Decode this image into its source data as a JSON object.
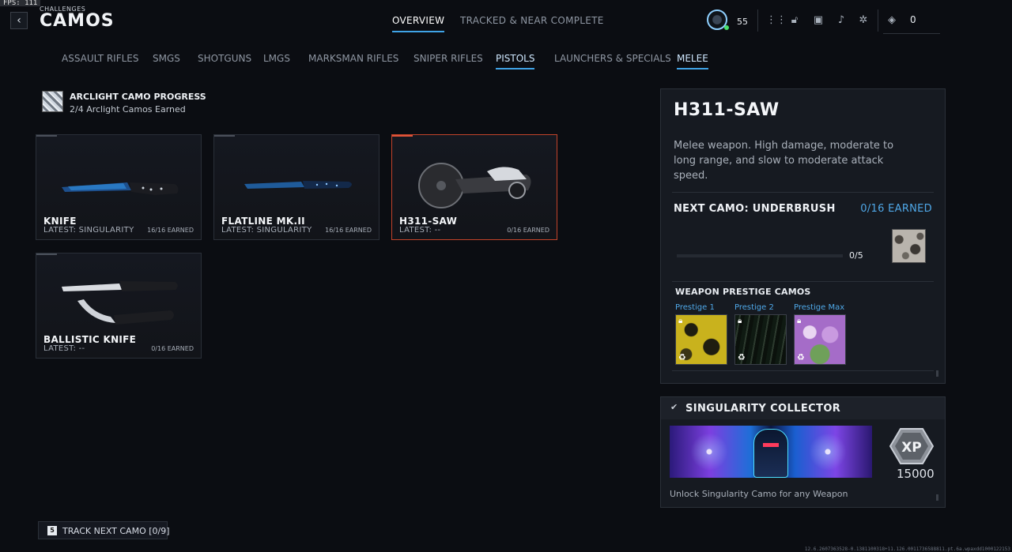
{
  "debug": {
    "fps": "FPS: 111"
  },
  "header": {
    "back_glyph": "‹",
    "subtitle": "CHALLENGES",
    "title": "CAMOS",
    "tabs": [
      {
        "label": "OVERVIEW",
        "active": true
      },
      {
        "label": "TRACKED & NEAR COMPLETE",
        "active": false
      }
    ]
  },
  "hud": {
    "rank_level": "55",
    "currency": "0",
    "icons": [
      "grid-icon",
      "lock-icon",
      "camera-icon",
      "bell-icon",
      "gear-icon",
      "currency-icon"
    ]
  },
  "categories": [
    {
      "label": "ASSAULT RIFLES",
      "active": false
    },
    {
      "label": "SMGS",
      "active": false
    },
    {
      "label": "SHOTGUNS",
      "active": false
    },
    {
      "label": "LMGS",
      "active": false
    },
    {
      "label": "MARKSMAN RIFLES",
      "active": false
    },
    {
      "label": "SNIPER RIFLES",
      "active": false
    },
    {
      "label": "PISTOLS",
      "active": true
    },
    {
      "label": "LAUNCHERS & SPECIALS",
      "active": false
    },
    {
      "label": "MELEE",
      "active": true
    }
  ],
  "arclight": {
    "title": "ARCLIGHT CAMO PROGRESS",
    "subtitle": "2/4 Arclight Camos Earned"
  },
  "weapons": [
    {
      "name": "KNIFE",
      "latest": "LATEST: SINGULARITY",
      "earned": "16/16 EARNED",
      "selected": false
    },
    {
      "name": "FLATLINE MK.II",
      "latest": "LATEST: SINGULARITY",
      "earned": "16/16 EARNED",
      "selected": false
    },
    {
      "name": "H311-SAW",
      "latest": "LATEST: --",
      "earned": "0/16 EARNED",
      "selected": true
    },
    {
      "name": "BALLISTIC KNIFE",
      "latest": "LATEST: --",
      "earned": "0/16 EARNED",
      "selected": false
    }
  ],
  "detail": {
    "title": "H311-SAW",
    "description": "Melee weapon. High damage, moderate to long range, and slow to moderate attack speed.",
    "next_camo_label": "NEXT CAMO: UNDERBRUSH",
    "next_camo_earned": "0/16 EARNED",
    "next_camo_progress": "0/5",
    "next_camo_fraction": 0,
    "prestige_heading": "WEAPON PRESTIGE CAMOS",
    "prestige": [
      {
        "label": "Prestige 1",
        "color_a": "#c9b21d",
        "color_b": "#1f1d10"
      },
      {
        "label": "Prestige 2",
        "color_a": "#0f1a12",
        "color_b": "#2c3a2e"
      },
      {
        "label": "Prestige Max",
        "color_a": "#a56cc8",
        "color_b": "#6fa05a"
      }
    ]
  },
  "reward": {
    "title": "SINGULARITY COLLECTOR",
    "xp_label": "XP",
    "xp_amount": "15000",
    "description": "Unlock Singularity Camo for any Weapon"
  },
  "footer": {
    "track_key": "5",
    "track_label": "TRACK NEXT CAMO [0/9]",
    "build_info": "12.6.2607363528-0.1381100318+11.126.0011736588811.pt.6a.wpaxdd1000122153"
  },
  "colors": {
    "accent": "#3fa3e6",
    "selected_border": "#c2432a",
    "link": "#4fa8e8"
  }
}
